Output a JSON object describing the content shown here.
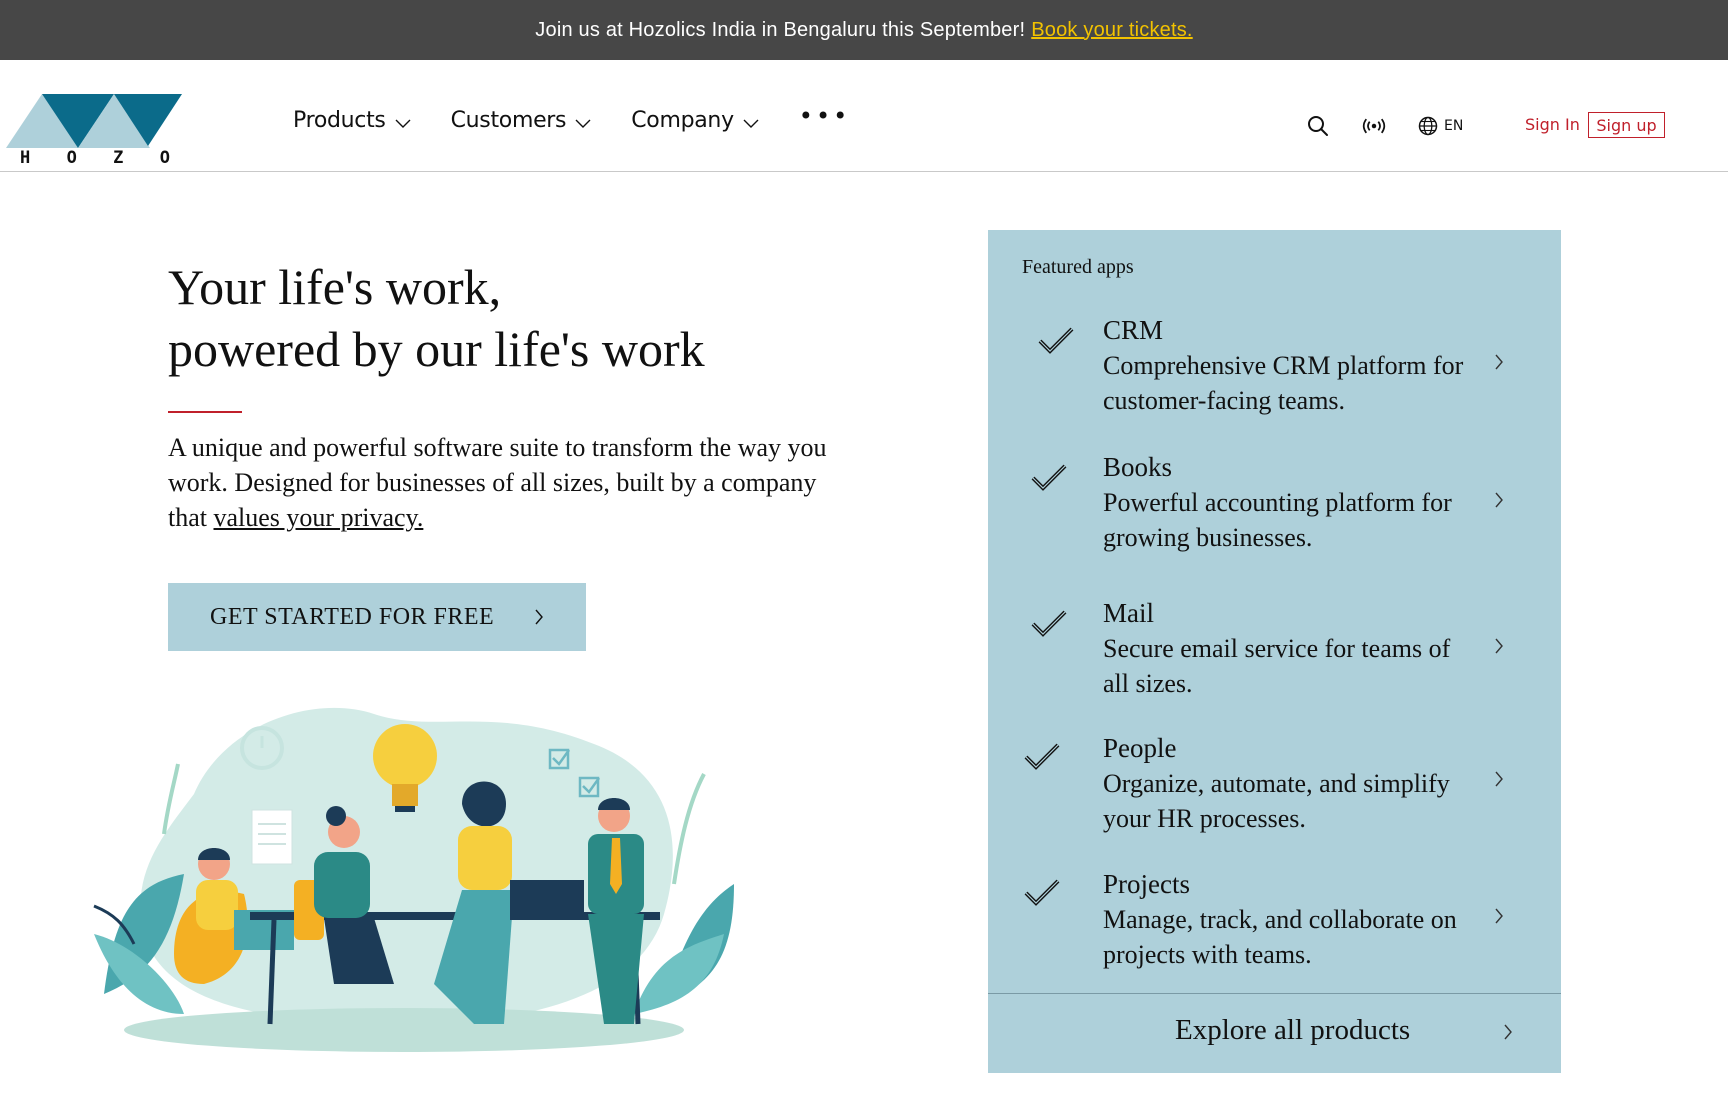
{
  "announcement": {
    "text": "Join us at Hozolics India in Bengaluru this September!",
    "link": "Book your tickets."
  },
  "logo": {
    "letters": [
      "H",
      "O",
      "Z",
      "O"
    ]
  },
  "nav": {
    "items": [
      {
        "label": "Products"
      },
      {
        "label": "Customers"
      },
      {
        "label": "Company"
      }
    ],
    "more": "•••"
  },
  "tools": {
    "language": "EN"
  },
  "auth": {
    "sign_in": "Sign In",
    "sign_up": "Sign up"
  },
  "hero": {
    "title_line1": "Your life's work,",
    "title_line2": "powered by our life's work",
    "description": "A unique and powerful software suite to transform the way you work. Designed for businesses of all sizes, built by a company that",
    "description_link": "values your privacy.",
    "cta": "GET STARTED FOR FREE"
  },
  "featured": {
    "title": "Featured apps",
    "apps": [
      {
        "name": "CRM",
        "description": "Comprehensive CRM platform for customer-facing teams."
      },
      {
        "name": "Books",
        "description": "Powerful accounting platform for growing businesses."
      },
      {
        "name": "Mail",
        "description": "Secure email service for teams of all sizes."
      },
      {
        "name": "People",
        "description": "Organize, automate, and simplify your HR processes."
      },
      {
        "name": "Projects",
        "description": "Manage, track, and collaborate on projects with teams."
      }
    ],
    "explore": "Explore all products"
  },
  "colors": {
    "announce_bg": "#474747",
    "announce_link": "#f2c200",
    "accent_red": "#c0202b",
    "panel_bg": "#aed0da",
    "logo_teal": "#0b6b8a",
    "logo_light": "#aed0da"
  }
}
